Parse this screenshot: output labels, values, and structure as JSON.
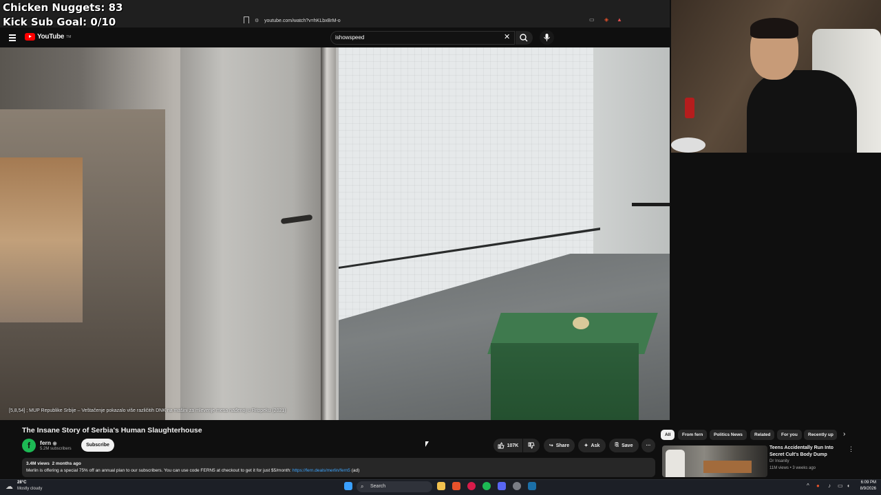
{
  "overlay": {
    "nuggets": "Chicken Nuggets: 83",
    "sub_goal": "Kick Sub Goal: 0/10"
  },
  "browser": {
    "url": "youtube.com/watch?v=hKLbxBrM-o"
  },
  "header": {
    "logo": "YouTube",
    "logo_tm": "TM",
    "search_value": "ishowspeed",
    "search_placeholder": "Search"
  },
  "video": {
    "caption": "[5,8,54] ; MUP Republike Srbije – Veštačenje pokazalo više različitih DNK na mašini za mlevenje mesa nađenoj u Ritopeku (2021)"
  },
  "details": {
    "title": "The Insane Story of Serbia's Human Slaughterhouse",
    "channel_name": "fern",
    "channel_initial": "f",
    "subscribers": "5.2M subscribers",
    "subscribe_label": "Subscribe",
    "likes": "107K",
    "share_label": "Share",
    "ask_label": "Ask",
    "save_label": "Save",
    "more_label": "···",
    "views": "3.4M views",
    "age": "2 months ago",
    "description": "Merlin is offering a special 75% off an annual plan to our subscribers. You can use code FERN5 at checkout to get it for just $5/month: ",
    "description_link": "https://fern.deals/merlin/fern5",
    "description_suffix": " (ad)"
  },
  "chips": [
    "All",
    "From fern",
    "Politics News",
    "Related",
    "For you",
    "Recently up"
  ],
  "recommendation": {
    "title": "Teens Accidentally Run Into Secret Cult's Body Dump",
    "channel": "Dr Insanity",
    "meta": "11M views • 3 weeks ago"
  },
  "taskbar": {
    "temperature": "28°C",
    "weather": "Mostly cloudy",
    "search_label": "Search",
    "time": "6:09 PM",
    "date": "8/9/2026"
  },
  "colors": {
    "background": "#0f0f0f",
    "youtube_red": "#ff0000",
    "link": "#3ea6ff",
    "channel_avatar": "#1db954"
  }
}
